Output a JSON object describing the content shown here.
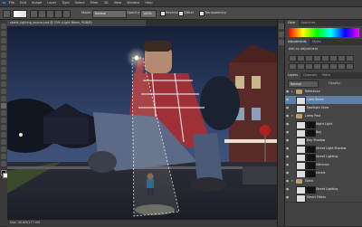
{
  "menu": {
    "app_logo": "Ps",
    "items": [
      "File",
      "Edit",
      "Image",
      "Layer",
      "Type",
      "Select",
      "Filter",
      "3D",
      "View",
      "Window",
      "Help"
    ]
  },
  "options": {
    "mode_label": "Mode:",
    "mode_value": "Normal",
    "opacity_label": "Opacity:",
    "opacity_value": "100%",
    "reverse_label": "Reverse",
    "dither_label": "Dither",
    "transparency_label": "Transparency"
  },
  "document": {
    "tab_title": "street_lighting_source.psd @ 25% (Light Beam, RGB/8)",
    "status": "Doc: 45.8M/177.0M"
  },
  "panels": {
    "top_tabs": [
      "Color",
      "Swatches"
    ],
    "adjust_tabs": [
      "Adjustments",
      "Styles"
    ],
    "adjust_title": "Add an adjustment",
    "layers_tabs": [
      "Layers",
      "Channels",
      "Paths"
    ],
    "blend_mode": "Normal",
    "opacity_label": "Opacity:",
    "layers": [
      {
        "name": "Reference",
        "type": "group",
        "selected": false
      },
      {
        "name": "Light Beam",
        "type": "layer",
        "selected": true
      },
      {
        "name": "Spotlight Glow",
        "type": "layer",
        "selected": false
      },
      {
        "name": "Lamp Post",
        "type": "group",
        "selected": false
      },
      {
        "name": "Night Light",
        "type": "layer",
        "selected": false
      },
      {
        "name": "Boy",
        "type": "layer",
        "selected": false
      },
      {
        "name": "Boy Shadow",
        "type": "layer",
        "selected": false
      },
      {
        "name": "Street Light Shadow",
        "type": "layer",
        "selected": false
      },
      {
        "name": "Street Lighting",
        "type": "layer",
        "selected": false
      },
      {
        "name": "Vibrance",
        "type": "layer",
        "selected": false
      },
      {
        "name": "Levels",
        "type": "layer",
        "selected": false
      },
      {
        "name": "Giant",
        "type": "group",
        "selected": false
      },
      {
        "name": "Street Lighting",
        "type": "layer",
        "selected": false
      },
      {
        "name": "Smart Filters",
        "type": "layer",
        "selected": false
      }
    ]
  },
  "colors": {
    "sky_top": "#15203a",
    "sky_bottom": "#3a4e78",
    "street": "#2c2f3a",
    "beam": "#e8e8c0",
    "selection": "#5d7fa8"
  }
}
